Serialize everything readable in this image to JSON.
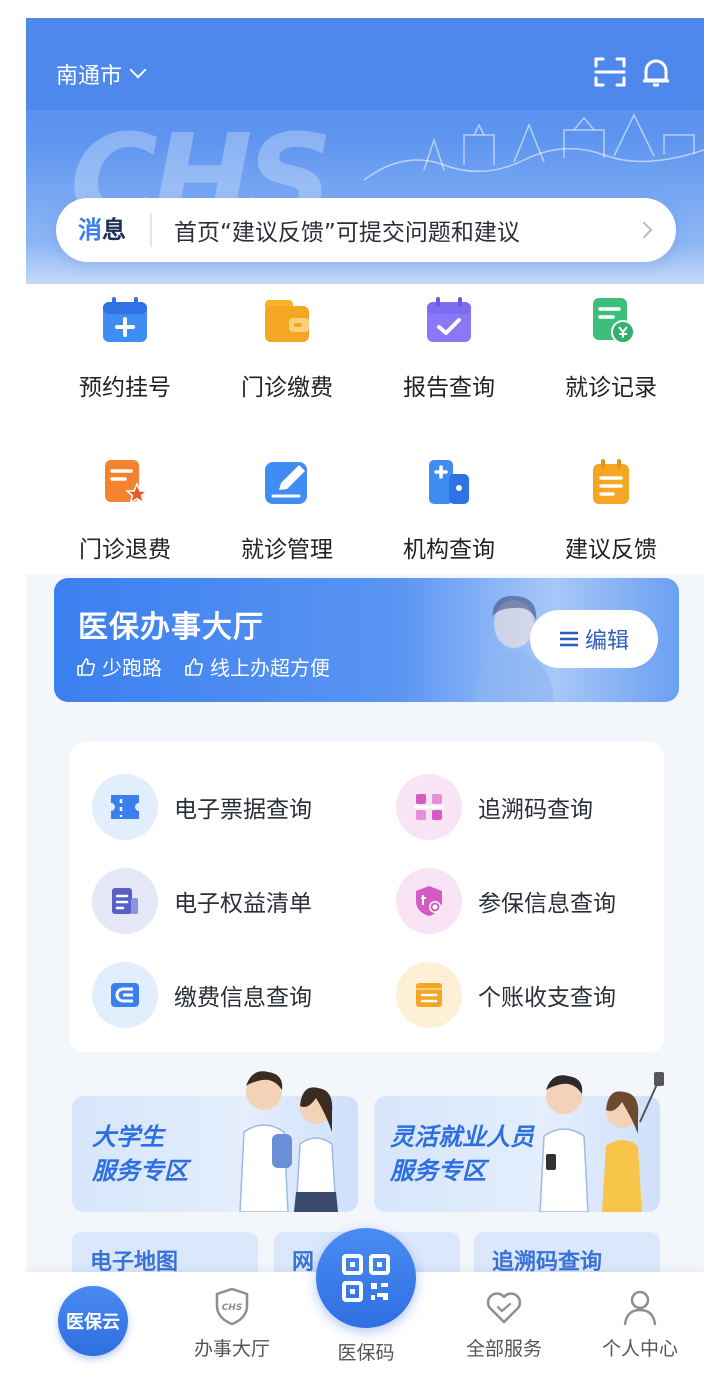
{
  "header": {
    "city": "南通市",
    "banner_watermark": "CHS"
  },
  "notice": {
    "tag_first": "消",
    "tag_rest": "息",
    "text": "首页“建议反馈”可提交问题和建议"
  },
  "grid": {
    "items": [
      {
        "label": "预约挂号",
        "icon": "calendar-plus-icon"
      },
      {
        "label": "门诊缴费",
        "icon": "wallet-icon"
      },
      {
        "label": "报告查询",
        "icon": "calendar-check-icon"
      },
      {
        "label": "就诊记录",
        "icon": "record-yen-icon"
      },
      {
        "label": "门诊退费",
        "icon": "refund-doc-icon"
      },
      {
        "label": "就诊管理",
        "icon": "edit-icon"
      },
      {
        "label": "机构查询",
        "icon": "building-icon"
      },
      {
        "label": "建议反馈",
        "icon": "clipboard-icon"
      }
    ]
  },
  "hall": {
    "title": "医保办事大厅",
    "sub1": "少跑路",
    "sub2": "线上办超方便",
    "edit_label": "编辑"
  },
  "services": {
    "items": [
      {
        "label": "电子票据查询",
        "icon": "ticket-icon"
      },
      {
        "label": "追溯码查询",
        "icon": "trace-code-icon"
      },
      {
        "label": "电子权益清单",
        "icon": "list-doc-icon"
      },
      {
        "label": "参保信息查询",
        "icon": "insurance-shield-icon"
      },
      {
        "label": "缴费信息查询",
        "icon": "payment-card-icon"
      },
      {
        "label": "个账收支查询",
        "icon": "account-book-icon"
      }
    ]
  },
  "zones": {
    "students_line1": "大学生",
    "students_line2": "服务专区",
    "flex_line1": "灵活就业人员",
    "flex_line2": "服务专区"
  },
  "partial_row": {
    "a": "电子地图",
    "b": "网",
    "c": "追溯码查询"
  },
  "bottom_nav": {
    "cloud": "医保云",
    "hall": "办事大厅",
    "qr": "医保码",
    "all": "全部服务",
    "me": "个人中心"
  },
  "colors": {
    "brand_blue": "#4f88ec",
    "accent_orange": "#f5a623",
    "accent_purple": "#7b6cf0",
    "accent_green": "#2fb26d"
  }
}
